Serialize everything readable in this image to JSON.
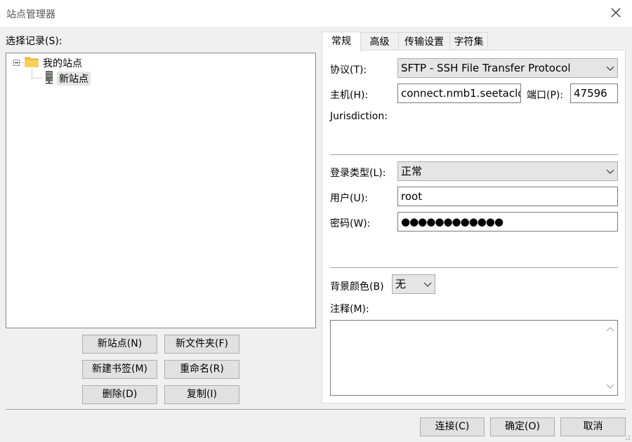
{
  "window": {
    "title": "站点管理器"
  },
  "left": {
    "select_label": "选择记录(S):",
    "tree": {
      "root": {
        "label": "我的站点"
      },
      "child": {
        "label": "新站点"
      }
    },
    "buttons": {
      "new_site": "新站点(N)",
      "new_folder": "新文件夹(F)",
      "new_bookmark": "新建书签(M)",
      "rename": "重命名(R)",
      "delete": "删除(D)",
      "copy": "复制(I)"
    }
  },
  "tabs": [
    "常规",
    "高级",
    "传输设置",
    "字符集"
  ],
  "general": {
    "protocol_label": "协议(T):",
    "protocol_value": "SFTP - SSH File Transfer Protocol",
    "host_label": "主机(H):",
    "host_value": "connect.nmb1.seetaclo",
    "port_label": "端口(P):",
    "port_value": "47596",
    "jurisdiction_label": "Jurisdiction:",
    "logon_type_label": "登录类型(L):",
    "logon_type_value": "正常",
    "user_label": "用户(U):",
    "user_value": "root",
    "password_label": "密码(W):",
    "password_value": "●●●●●●●●●●●●",
    "bgcolor_label": "背景颜色(B)",
    "bgcolor_value": "无",
    "comments_label": "注释(M):"
  },
  "footer": {
    "connect": "连接(C)",
    "ok": "确定(O)",
    "cancel": "取消"
  },
  "icons": {
    "close": "close-icon",
    "folder": "folder-icon",
    "server": "server-icon",
    "chevron": "chevron-down-icon"
  },
  "colors": {
    "folder": "#f6c342",
    "background": "#f0f0f0",
    "button": "#e1e1e1"
  }
}
